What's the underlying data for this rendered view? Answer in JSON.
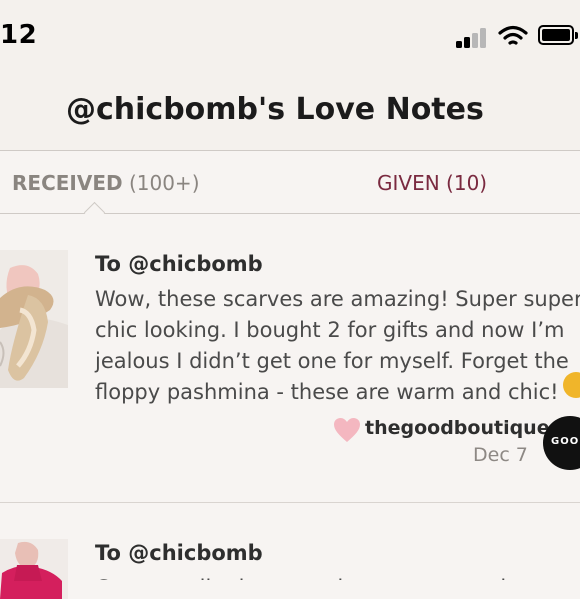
{
  "status_bar": {
    "time": "12",
    "signal_icon": "cellular-signal-icon",
    "wifi_icon": "wifi-icon",
    "battery_icon": "battery-icon"
  },
  "header": {
    "title": "@chicbomb's Love Notes"
  },
  "tabs": [
    {
      "label": "RECEIVED",
      "count": "(100+)",
      "active": true
    },
    {
      "label": "GIVEN",
      "count": "(10)",
      "active": false
    }
  ],
  "notes": [
    {
      "to": "To @chicbomb",
      "message_lines": [
        "Wow, these scarves are amazing! Super super",
        "chic looking. I bought 2 for gifts and now I’m",
        "jealous I didn’t get one for myself. Forget the",
        "floppy pashmina - these are warm and chic!"
      ],
      "from_user": "thegoodboutique",
      "date": "Dec 7",
      "heart_icon": "heart-icon",
      "avatar_text": "GOO"
    },
    {
      "to": "To @chicbomb",
      "message_lines": [
        "Great quality items and customer service"
      ]
    }
  ],
  "colors": {
    "given_tab": "#7a2a40",
    "heart": "#f4b7c0",
    "background": "#f7f4f2"
  }
}
